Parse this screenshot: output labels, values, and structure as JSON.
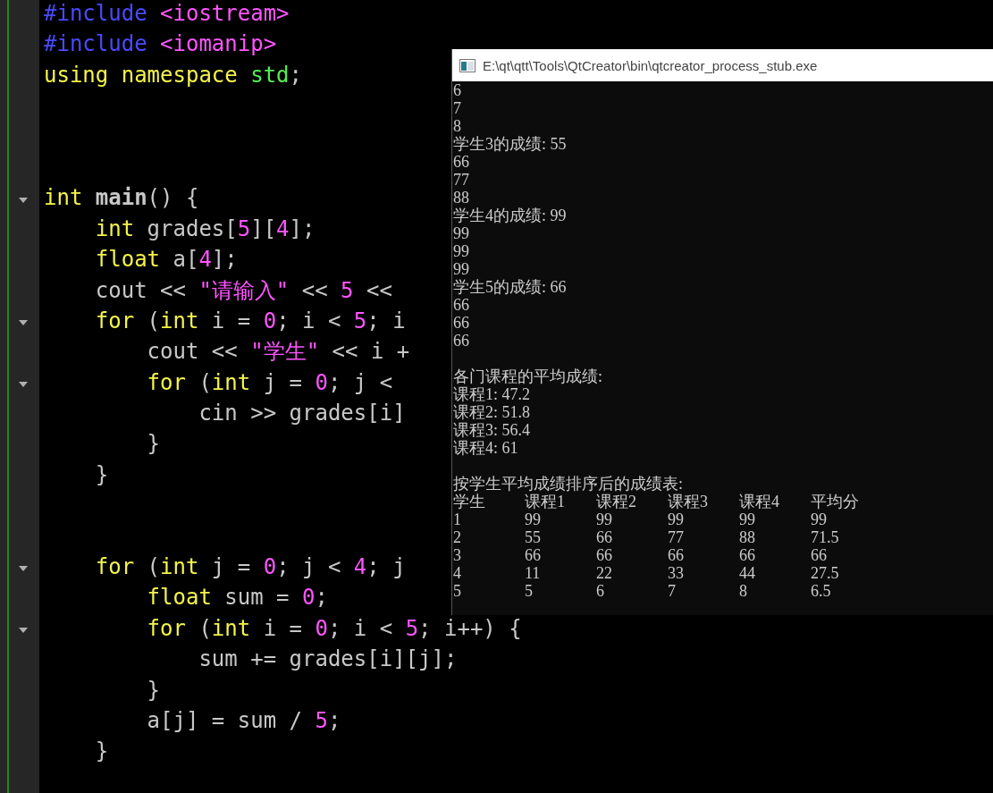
{
  "editor": {
    "lines": [
      {
        "foldable": false,
        "tokens": [
          {
            "kind": "pp",
            "text": "#include "
          },
          {
            "kind": "inc",
            "text": "<iostream>"
          }
        ]
      },
      {
        "foldable": false,
        "tokens": [
          {
            "kind": "pp",
            "text": "#include "
          },
          {
            "kind": "inc",
            "text": "<iomanip>"
          }
        ]
      },
      {
        "foldable": false,
        "tokens": [
          {
            "kind": "kw",
            "text": "using namespace "
          },
          {
            "kind": "ns",
            "text": "std"
          },
          {
            "kind": "plain",
            "text": ";"
          }
        ]
      },
      {
        "foldable": false
      },
      {
        "foldable": false
      },
      {
        "foldable": false
      },
      {
        "foldable": true,
        "tokens": [
          {
            "kind": "kw",
            "text": "int "
          },
          {
            "kind": "fn",
            "text": "main"
          },
          {
            "kind": "plain",
            "text": "() {"
          }
        ]
      },
      {
        "foldable": false,
        "tokens": [
          {
            "kind": "kw",
            "text": "    int"
          },
          {
            "kind": "plain",
            "text": " grades["
          },
          {
            "kind": "num",
            "text": "5"
          },
          {
            "kind": "plain",
            "text": "]["
          },
          {
            "kind": "num",
            "text": "4"
          },
          {
            "kind": "plain",
            "text": "];"
          }
        ]
      },
      {
        "foldable": false,
        "tokens": [
          {
            "kind": "kw",
            "text": "    float"
          },
          {
            "kind": "plain",
            "text": " a["
          },
          {
            "kind": "num",
            "text": "4"
          },
          {
            "kind": "plain",
            "text": "];"
          }
        ]
      },
      {
        "foldable": false,
        "tokens": [
          {
            "kind": "plain",
            "text": "    cout << "
          },
          {
            "kind": "str",
            "text": "\"请输入\""
          },
          {
            "kind": "plain",
            "text": " << "
          },
          {
            "kind": "num",
            "text": "5"
          },
          {
            "kind": "plain",
            "text": " <<"
          }
        ]
      },
      {
        "foldable": true,
        "tokens": [
          {
            "kind": "kw",
            "text": "    for"
          },
          {
            "kind": "plain",
            "text": " ("
          },
          {
            "kind": "kw",
            "text": "int"
          },
          {
            "kind": "plain",
            "text": " i = "
          },
          {
            "kind": "num",
            "text": "0"
          },
          {
            "kind": "plain",
            "text": "; i < "
          },
          {
            "kind": "num",
            "text": "5"
          },
          {
            "kind": "plain",
            "text": "; i"
          }
        ]
      },
      {
        "foldable": false,
        "tokens": [
          {
            "kind": "plain",
            "text": "        cout << "
          },
          {
            "kind": "str",
            "text": "\"学生\""
          },
          {
            "kind": "plain",
            "text": " << i +"
          }
        ]
      },
      {
        "foldable": true,
        "tokens": [
          {
            "kind": "kw",
            "text": "        for"
          },
          {
            "kind": "plain",
            "text": " ("
          },
          {
            "kind": "kw",
            "text": "int"
          },
          {
            "kind": "plain",
            "text": " j = "
          },
          {
            "kind": "num",
            "text": "0"
          },
          {
            "kind": "plain",
            "text": "; j <"
          }
        ]
      },
      {
        "foldable": false,
        "tokens": [
          {
            "kind": "plain",
            "text": "            cin >> grades[i]"
          }
        ]
      },
      {
        "foldable": false,
        "tokens": [
          {
            "kind": "plain",
            "text": "        }"
          }
        ]
      },
      {
        "foldable": false,
        "tokens": [
          {
            "kind": "plain",
            "text": "    }"
          }
        ]
      },
      {
        "foldable": false
      },
      {
        "foldable": false
      },
      {
        "foldable": true,
        "tokens": [
          {
            "kind": "kw",
            "text": "    for"
          },
          {
            "kind": "plain",
            "text": " ("
          },
          {
            "kind": "kw",
            "text": "int"
          },
          {
            "kind": "plain",
            "text": " j = "
          },
          {
            "kind": "num",
            "text": "0"
          },
          {
            "kind": "plain",
            "text": "; j < "
          },
          {
            "kind": "num",
            "text": "4"
          },
          {
            "kind": "plain",
            "text": "; j"
          }
        ]
      },
      {
        "foldable": false,
        "tokens": [
          {
            "kind": "kw",
            "text": "        float"
          },
          {
            "kind": "plain",
            "text": " sum = "
          },
          {
            "kind": "num",
            "text": "0"
          },
          {
            "kind": "plain",
            "text": ";"
          }
        ]
      },
      {
        "foldable": true,
        "tokens": [
          {
            "kind": "kw",
            "text": "        for"
          },
          {
            "kind": "plain",
            "text": " ("
          },
          {
            "kind": "kw",
            "text": "int"
          },
          {
            "kind": "plain",
            "text": " i = "
          },
          {
            "kind": "num",
            "text": "0"
          },
          {
            "kind": "plain",
            "text": "; i < "
          },
          {
            "kind": "num",
            "text": "5"
          },
          {
            "kind": "plain",
            "text": "; i++) {"
          }
        ]
      },
      {
        "foldable": false,
        "tokens": [
          {
            "kind": "plain",
            "text": "            sum += grades[i][j];"
          }
        ]
      },
      {
        "foldable": false,
        "tokens": [
          {
            "kind": "plain",
            "text": "        }"
          }
        ]
      },
      {
        "foldable": false,
        "tokens": [
          {
            "kind": "plain",
            "text": "        a[j] = sum / "
          },
          {
            "kind": "num",
            "text": "5"
          },
          {
            "kind": "plain",
            "text": ";"
          }
        ]
      },
      {
        "foldable": false,
        "tokens": [
          {
            "kind": "plain",
            "text": "    }"
          }
        ]
      },
      {
        "foldable": false
      }
    ]
  },
  "console": {
    "title": "E:\\qt\\qtt\\Tools\\QtCreator\\bin\\qtcreator_process_stub.exe",
    "groups": [
      [
        "6",
        "7",
        "8",
        "学生3的成绩: 55",
        "66",
        "77",
        "88",
        "学生4的成绩: 99",
        "99",
        "99",
        "99",
        "学生5的成绩: 66",
        "66",
        "66",
        "66"
      ],
      [
        "各门课程的平均成绩:",
        "课程1: 47.2",
        "课程2: 51.8",
        "课程3: 56.4",
        "课程4: 61"
      ],
      [
        "按学生平均成绩排序后的成绩表:"
      ]
    ],
    "table": {
      "columns": [
        "学生",
        "课程1",
        "课程2",
        "课程3",
        "课程4",
        "平均分"
      ],
      "rows": [
        [
          "1",
          "99",
          "99",
          "99",
          "99",
          "99"
        ],
        [
          "2",
          "55",
          "66",
          "77",
          "88",
          "71.5"
        ],
        [
          "3",
          "66",
          "66",
          "66",
          "66",
          "66"
        ],
        [
          "4",
          "11",
          "22",
          "33",
          "44",
          "27.5"
        ],
        [
          "5",
          "5",
          "6",
          "7",
          "8",
          "6.5"
        ]
      ]
    }
  }
}
